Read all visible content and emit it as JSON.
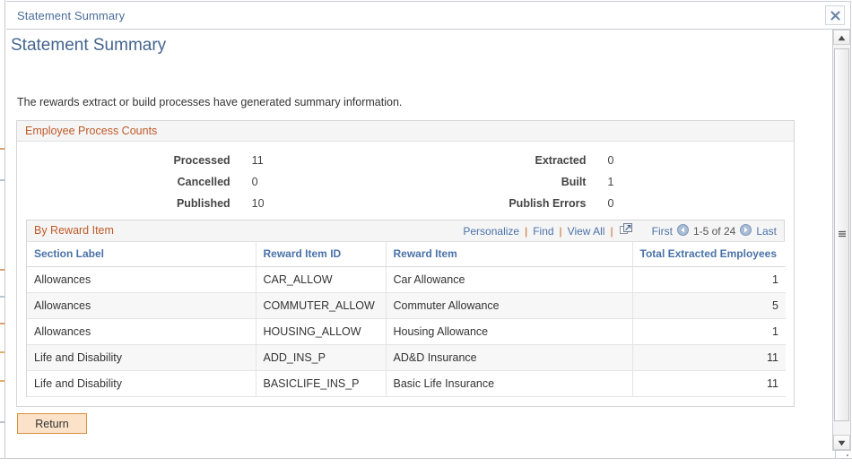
{
  "window": {
    "title": "Statement Summary",
    "close_icon": "close-icon"
  },
  "page": {
    "title": "Statement Summary",
    "intro": "The rewards extract or build processes have generated summary information."
  },
  "process_counts": {
    "header": "Employee Process Counts",
    "rows": [
      {
        "left_label": "Processed",
        "left_value": "11",
        "right_label": "Extracted",
        "right_value": "0"
      },
      {
        "left_label": "Cancelled",
        "left_value": "0",
        "right_label": "Built",
        "right_value": "1"
      },
      {
        "left_label": "Published",
        "left_value": "10",
        "right_label": "Publish Errors",
        "right_value": "0"
      }
    ]
  },
  "grid": {
    "title": "By Reward Item",
    "actions": {
      "personalize": "Personalize",
      "find": "Find",
      "view_all": "View All",
      "separator": "|",
      "new_window_icon": "open-in-new-window-icon"
    },
    "pager": {
      "first": "First",
      "prev_icon": "previous-page-icon",
      "range": "1-5 of 24",
      "next_icon": "next-page-icon",
      "last": "Last"
    },
    "columns": [
      "Section Label",
      "Reward Item ID",
      "Reward Item",
      "Total Extracted Employees"
    ],
    "rows": [
      {
        "section_label": "Allowances",
        "reward_item_id": "CAR_ALLOW",
        "reward_item": "Car Allowance",
        "total_extracted_employees": "1"
      },
      {
        "section_label": "Allowances",
        "reward_item_id": "COMMUTER_ALLOW",
        "reward_item": "Commuter Allowance",
        "total_extracted_employees": "5"
      },
      {
        "section_label": "Allowances",
        "reward_item_id": "HOUSING_ALLOW",
        "reward_item": "Housing Allowance",
        "total_extracted_employees": "1"
      },
      {
        "section_label": "Life and Disability",
        "reward_item_id": "ADD_INS_P",
        "reward_item": "AD&D Insurance",
        "total_extracted_employees": "11"
      },
      {
        "section_label": "Life and Disability",
        "reward_item_id": "BASICLIFE_INS_P",
        "reward_item": "Basic Life Insurance",
        "total_extracted_employees": "11"
      }
    ]
  },
  "footer": {
    "return_label": "Return"
  },
  "scrollbar": {
    "up_icon": "scroll-up-icon",
    "down_icon": "scroll-down-icon",
    "thumb": "scrollbar-thumb",
    "resize_icon": "resize-grip-icon"
  },
  "colors": {
    "accent_orange": "#bf5a28",
    "link_blue": "#4a72a8",
    "title_blue": "#44658f",
    "button_bg": "#fbe2c8",
    "button_border": "#d9913f",
    "row_alt": "#f7f7f7"
  }
}
